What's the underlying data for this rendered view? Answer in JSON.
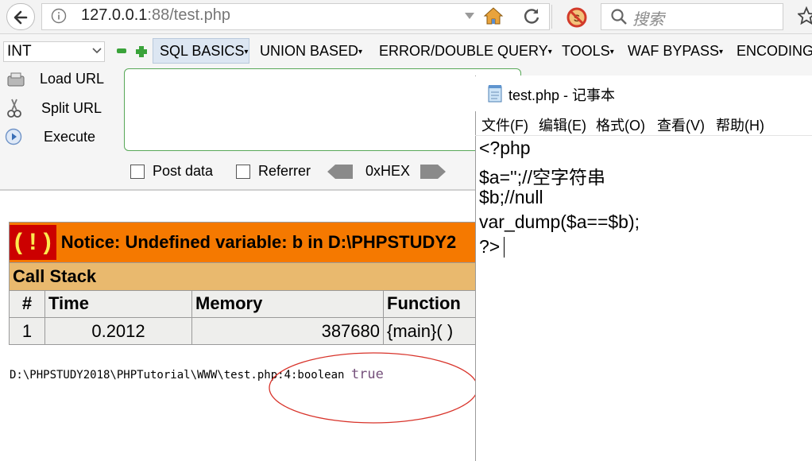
{
  "browser": {
    "url_host": "127.0.0.1",
    "url_rest": ":88/test.php",
    "search_placeholder": "搜索",
    "icons": [
      "back-arrow-icon",
      "info-icon",
      "dropdown-arrow-icon",
      "home-icon",
      "reload-icon",
      "noscript-icon",
      "search-icon",
      "bookmark-star-icon"
    ]
  },
  "hackbar": {
    "select_value": "INT",
    "menus": [
      "SQL BASICS",
      "UNION BASED",
      "ERROR/DOUBLE QUERY",
      "TOOLS",
      "WAF BYPASS",
      "ENCODING"
    ],
    "actions": [
      {
        "label": "Load URL",
        "icon": "load-url-icon"
      },
      {
        "label": "Split URL",
        "icon": "scissors-icon"
      },
      {
        "label": "Execute",
        "icon": "play-icon"
      }
    ],
    "post_data_label": "Post data",
    "referrer_label": "Referrer",
    "hex_label": "0xHEX"
  },
  "notice": {
    "badge": "( ! )",
    "message": "Notice: Undefined variable: b in D:\\PHPSTUDY2",
    "callstack_label": "Call Stack",
    "columns": [
      "#",
      "Time",
      "Memory",
      "Function"
    ],
    "row": {
      "num": "1",
      "time": "0.2012",
      "memory": "387680",
      "function": "{main}( )"
    }
  },
  "output": {
    "prefix": "D:\\PHPSTUDY2018\\PHPTutorial\\WWW\\test.php:4:boolean",
    "value": "true"
  },
  "notepad": {
    "title": "test.php - 记事本",
    "menus": [
      "文件(F)",
      "编辑(E)",
      "格式(O)",
      "查看(V)",
      "帮助(H)"
    ],
    "lines": [
      "<?php",
      "$a='';//空字符串",
      "$b;//null",
      "var_dump($a==$b);",
      "?>"
    ]
  }
}
